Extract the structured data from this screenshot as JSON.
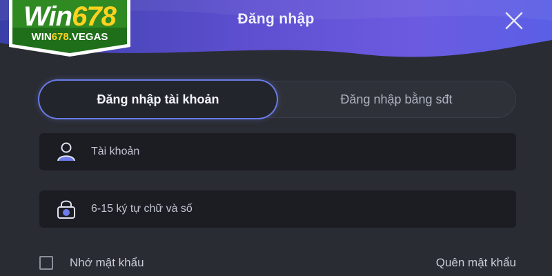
{
  "brand": {
    "name_part1": "Win",
    "name_part2": "678",
    "domain_part1": "WIN",
    "domain_part2": "678",
    "domain_part3": ".VEGAS"
  },
  "dialog": {
    "title": "Đăng nhập"
  },
  "tabs": [
    {
      "label": "Đăng nhập tài khoản",
      "active": true
    },
    {
      "label": "Đăng nhập bằng sđt",
      "active": false
    }
  ],
  "fields": {
    "account": {
      "placeholder": "Tài khoản",
      "value": "",
      "icon": "user-icon"
    },
    "password": {
      "placeholder": "6-15 ký tự chữ và số",
      "value": "",
      "icon": "lock-icon"
    }
  },
  "options": {
    "remember_label": "Nhớ mật khẩu",
    "remember_checked": false,
    "forgot_label": "Quên mật khẩu"
  },
  "colors": {
    "header_gradient_start": "#3a3fa8",
    "header_gradient_end": "#6c5be0",
    "panel_background": "#2a2c33",
    "input_background": "#1c1d22",
    "active_tab_outline": "#6a7be8",
    "logo_green": "#1f6f1a",
    "logo_yellow": "#ffd21f"
  }
}
